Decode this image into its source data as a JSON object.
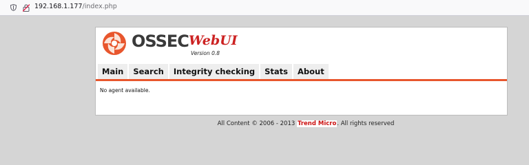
{
  "browser": {
    "url_host": "192.168.1.177",
    "url_path": "/index.php"
  },
  "logo": {
    "name": "OSSEC",
    "product": "WebUI",
    "version": "Version 0.8"
  },
  "nav": {
    "items": [
      "Main",
      "Search",
      "Integrity checking",
      "Stats",
      "About"
    ]
  },
  "content": {
    "message": "No agent available."
  },
  "footer": {
    "prefix": "All Content © 2006 - 2013",
    "brand": "Trend Micro",
    "suffix": ". All rights reserved"
  },
  "colors": {
    "accent": "#e8562d",
    "brand_red": "#cc1111"
  },
  "icons": {
    "address_bar_left": "shield-icon",
    "address_bar_security": "insecure-lock-icon",
    "logo_mark": "ossec-swirl-icon"
  }
}
